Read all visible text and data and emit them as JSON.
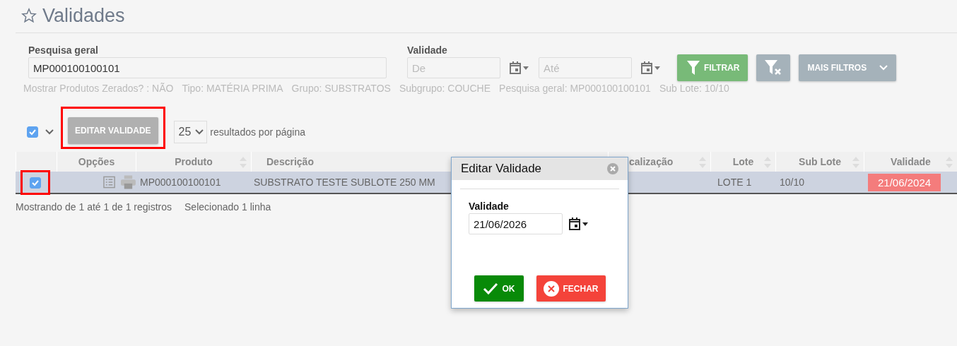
{
  "page": {
    "title": "Validades"
  },
  "filters": {
    "search": {
      "label": "Pesquisa geral",
      "value": "MP000100100101"
    },
    "date": {
      "label": "Validade",
      "from_placeholder": "De",
      "to_placeholder": "Até"
    },
    "filter_button": "FILTRAR",
    "more_button": "MAIS FILTROS"
  },
  "active_filters": [
    "Mostrar Produtos Zerados? : NÃO",
    "Tipo: MATÉRIA PRIMA",
    "Grupo: SUBSTRATOS",
    "Subgrupo: COUCHE",
    "Pesquisa geral: MP000100100101",
    "Sub Lote: 10/10"
  ],
  "toolbar": {
    "select_all": {
      "checked": true
    },
    "edit_button": {
      "label": "EDITAR VALIDADE",
      "disabled": true,
      "highlighted": true
    },
    "page_size": "25",
    "page_size_label": "resultados por página"
  },
  "table": {
    "columns": [
      {
        "label": "Opções",
        "sortable": false
      },
      {
        "label": "Produto",
        "sortable": true
      },
      {
        "label": "Descrição"
      },
      {
        "label": "calização",
        "sortable": true
      },
      {
        "label": "Lote",
        "sortable": true
      },
      {
        "label": "Sub Lote",
        "sortable": true
      },
      {
        "label": "Validade",
        "sortable": true
      }
    ],
    "rows": [
      {
        "selected": true,
        "checked": true,
        "highlighted": true,
        "produto": "MP000100100101",
        "descricao": "SUBSTRATO TESTE SUBLOTE 250 MM",
        "lote": "LOTE 1",
        "sub_lote": "10/10",
        "validade": "21/06/2024",
        "expired": true
      }
    ]
  },
  "footer": {
    "showing": "Mostrando de 1 até 1 de 1 registros",
    "selected": "Selecionado 1 linha"
  },
  "dialog": {
    "title": "Editar Validade",
    "field_label": "Validade",
    "value": "21/06/2026",
    "ok": "OK",
    "close": "FECHAR"
  }
}
